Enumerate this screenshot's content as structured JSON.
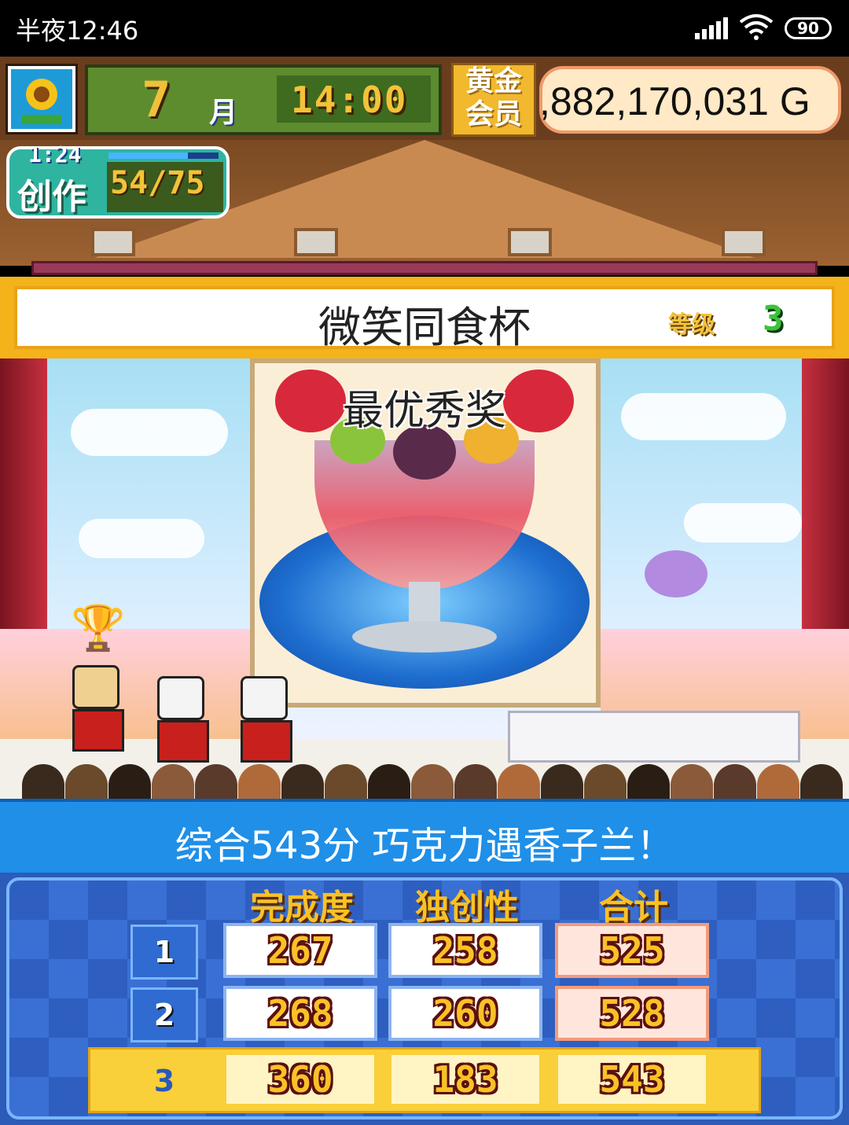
{
  "status_bar": {
    "time": "半夜12:46",
    "battery": "90"
  },
  "hud": {
    "month_number": "7",
    "month_label": "月",
    "clock": "14:00",
    "gold_member_label": "黄金会员",
    "money": ",882,170,031 G",
    "create_timer": "1:24",
    "create_label": "创作",
    "create_count": "54/75",
    "create_progress": 0.72
  },
  "contest": {
    "title": "微笑同食杯",
    "grade_label": "等级",
    "grade_value": "3",
    "award": "最优秀奖"
  },
  "result": {
    "message": "综合543分 巧克力遇香子兰！"
  },
  "scoreboard": {
    "columns": [
      "完成度",
      "独创性",
      "合计"
    ],
    "rows": [
      {
        "rank": "1",
        "completion": "267",
        "originality": "258",
        "total": "525"
      },
      {
        "rank": "2",
        "completion": "268",
        "originality": "260",
        "total": "528"
      },
      {
        "rank": "3",
        "completion": "360",
        "originality": "183",
        "total": "543"
      }
    ],
    "highlight_color": "#f9cf3a"
  },
  "icons": {
    "flower": "sunflower-icon",
    "trophy": "trophy-icon",
    "signal": "signal-icon",
    "wifi": "wifi-icon",
    "battery": "battery-icon"
  }
}
